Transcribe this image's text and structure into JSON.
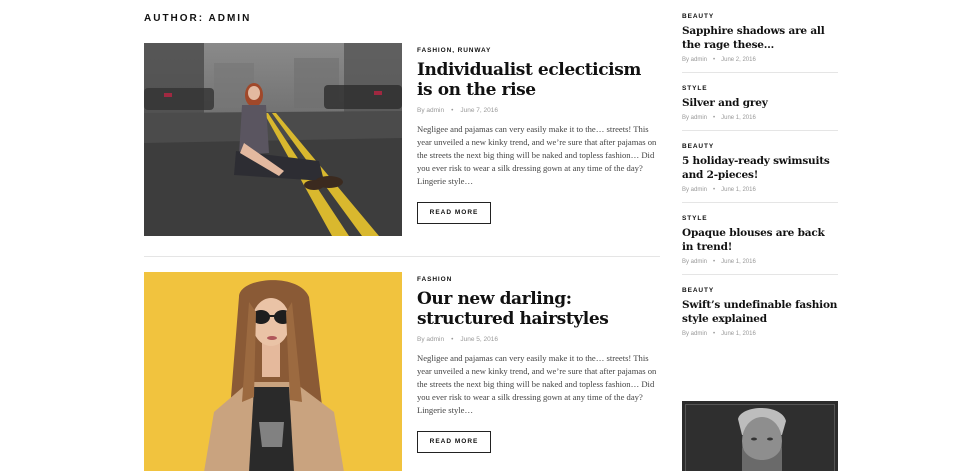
{
  "page": {
    "heading": "AUTHOR: ADMIN"
  },
  "posts": [
    {
      "category": "FASHION, RUNWAY",
      "title": "Individualist eclecticism is on the rise",
      "author": "By admin",
      "date": "June 7, 2016",
      "excerpt": "Negligee and pajamas can very easily make it to the… streets! This year unveiled a new kinky trend, and we’re sure that after pajamas on the streets the next big thing will be naked and topless fashion… Did you ever risk to wear a silk dressing gown at any time of the day? Lingerie style…",
      "read_more": "READ MORE"
    },
    {
      "category": "FASHION",
      "title": "Our new darling: structured hairstyles",
      "author": "By admin",
      "date": "June 5, 2016",
      "excerpt": "Negligee and pajamas can very easily make it to the… streets! This year unveiled a new kinky trend, and we’re sure that after pajamas on the streets the next big thing will be naked and topless fashion… Did you ever risk to wear a silk dressing gown at any time of the day? Lingerie style…",
      "read_more": "READ MORE"
    }
  ],
  "sidebar": [
    {
      "category": "BEAUTY",
      "title": "Sapphire shadows are all the rage these…",
      "author": "By admin",
      "date": "June 2, 2016"
    },
    {
      "category": "STYLE",
      "title": "Silver and grey",
      "author": "By admin",
      "date": "June 1, 2016"
    },
    {
      "category": "BEAUTY",
      "title": "5 holiday-ready swimsuits and 2-pieces!",
      "author": "By admin",
      "date": "June 1, 2016"
    },
    {
      "category": "STYLE",
      "title": "Opaque blouses are back in trend!",
      "author": "By admin",
      "date": "June 1, 2016"
    },
    {
      "category": "BEAUTY",
      "title": "Swift’s undefinable fashion style explained",
      "author": "By admin",
      "date": "June 1, 2016"
    }
  ],
  "meta_separator": "•"
}
